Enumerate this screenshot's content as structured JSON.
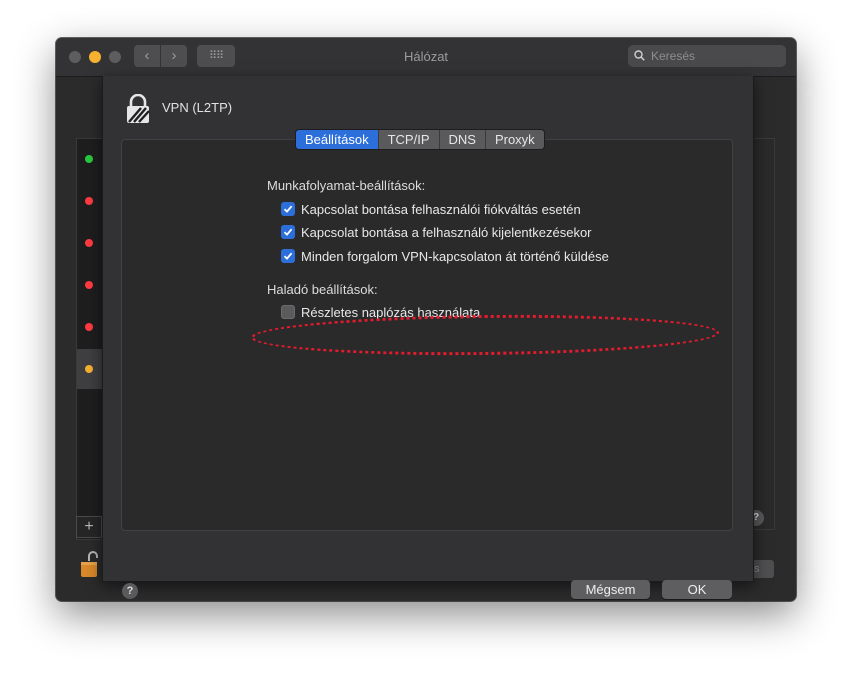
{
  "window": {
    "title": "Hálózat",
    "search_placeholder": "Keresés",
    "nav_back": "‹",
    "nav_forward": "›",
    "grid": "⠿⠿"
  },
  "services": {
    "status_colors": [
      "#28c840",
      "#ff3b41",
      "#ff3b41",
      "#ff3b41",
      "#ff3b41",
      "#f5b12f"
    ],
    "add_label": "+"
  },
  "background": {
    "help_label": "?",
    "button_partial": "s"
  },
  "sheet": {
    "vpn_name": "VPN (L2TP)",
    "tabs": [
      {
        "label": "Beállítások",
        "active": true
      },
      {
        "label": "TCP/IP",
        "active": false
      },
      {
        "label": "DNS",
        "active": false
      },
      {
        "label": "Proxyk",
        "active": false
      }
    ],
    "workflow_title": "Munkafolyamat-beállítások:",
    "workflow_options": [
      {
        "label": "Kapcsolat bontása felhasználói fiókváltás esetén",
        "checked": true
      },
      {
        "label": "Kapcsolat bontása a felhasználó kijelentkezésekor",
        "checked": true
      },
      {
        "label": "Minden forgalom VPN-kapcsolaton át történő küldése",
        "checked": true
      }
    ],
    "advanced_title": "Haladó beállítások:",
    "advanced_options": [
      {
        "label": "Részletes naplózás használata",
        "checked": false
      }
    ],
    "help_label": "?",
    "cancel_label": "Mégsem",
    "ok_label": "OK"
  },
  "accent_color": "#2c6fdb",
  "highlight_color": "#e41b2d"
}
